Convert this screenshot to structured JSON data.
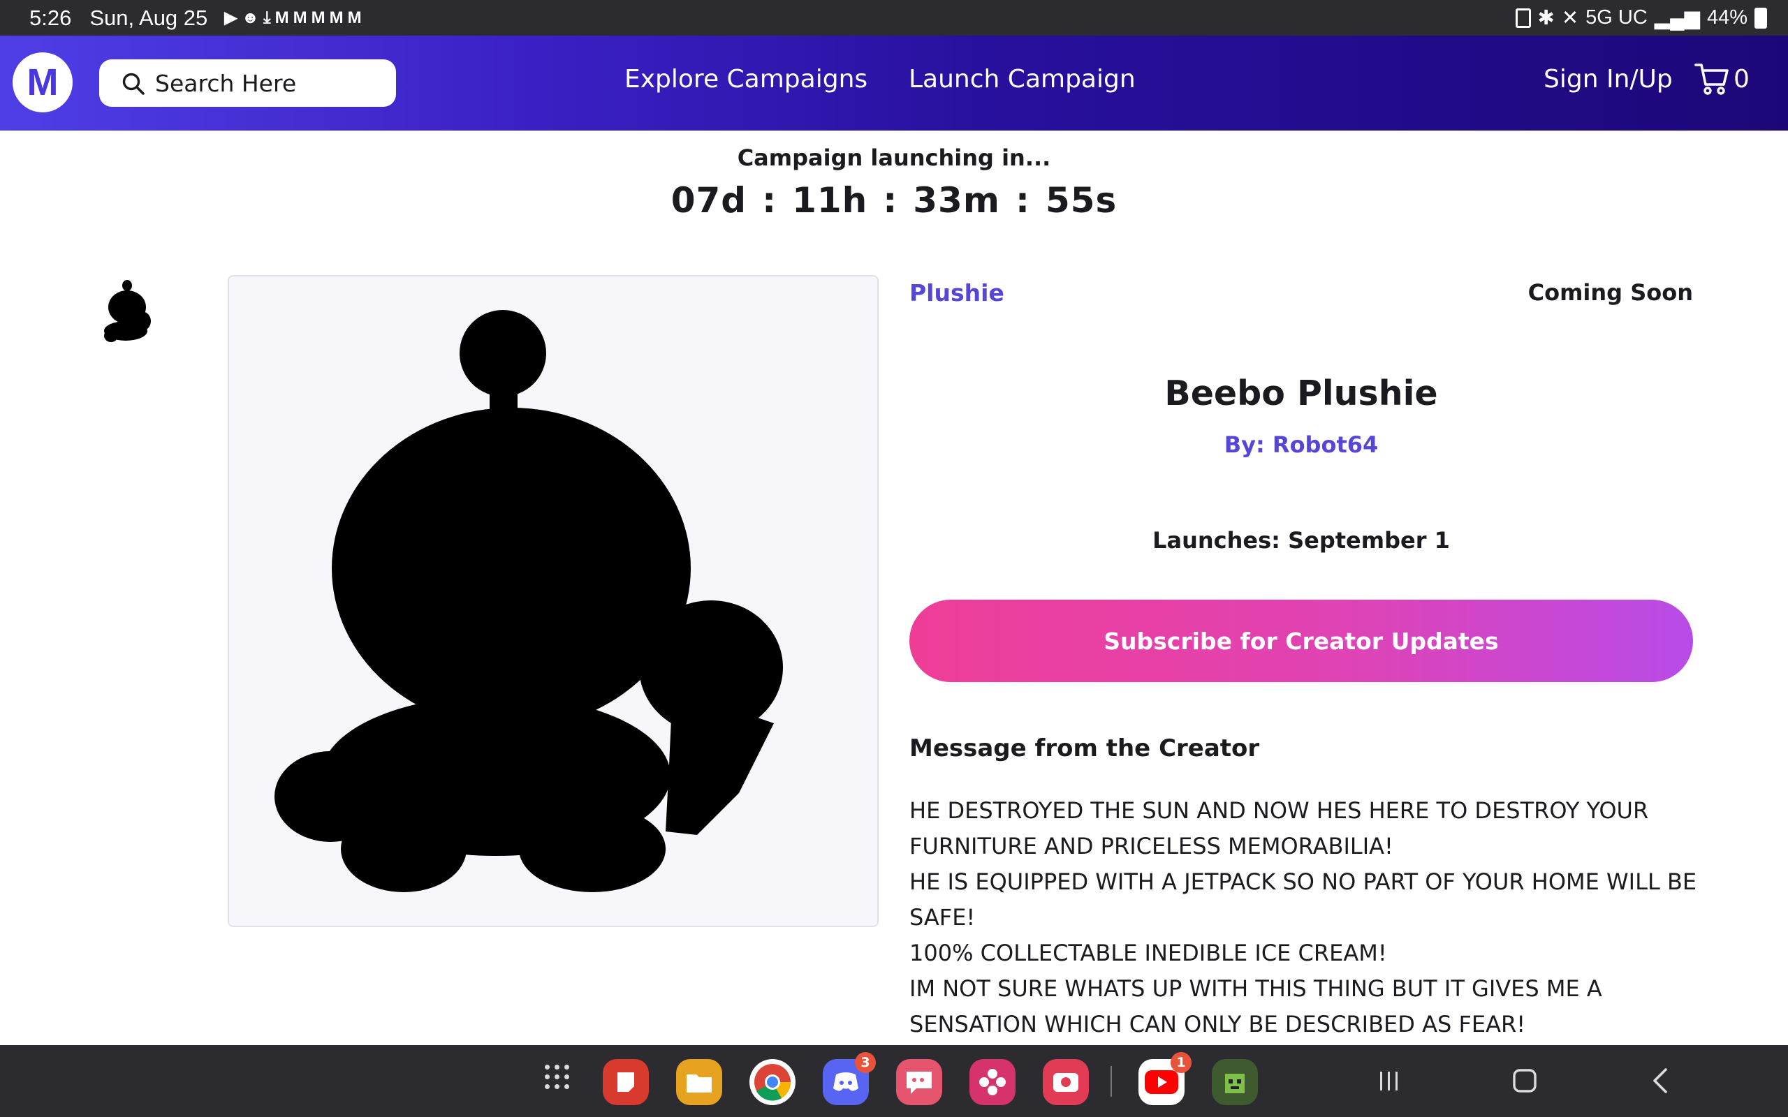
{
  "status_bar": {
    "time": "5:26",
    "date": "Sun, Aug 25",
    "notification_icons": [
      "youtube-icon",
      "discord-icon",
      "download-icon",
      "gmail-icon",
      "gmail-icon",
      "gmail-icon",
      "gmail-icon",
      "gmail-icon"
    ],
    "network": "5G UC",
    "battery": "44%"
  },
  "header": {
    "logo_letter": "M",
    "search_placeholder": "Search Here",
    "nav_explore": "Explore Campaigns",
    "nav_launch": "Launch Campaign",
    "sign_in": "Sign In/Up",
    "cart_count": "0"
  },
  "countdown": {
    "title": "Campaign launching in...",
    "days": "07d",
    "hours": "11h",
    "minutes": "33m",
    "seconds": "55s",
    "separator": ":"
  },
  "product": {
    "category": "Plushie",
    "status": "Coming Soon",
    "title": "Beebo Plushie",
    "author": "By: Robot64",
    "launches": "Launches: September 1",
    "subscribe_label": "Subscribe for Creator Updates",
    "message_title": "Message from the Creator",
    "message_lines": [
      "HE DESTROYED THE SUN AND NOW HES HERE TO DESTROY YOUR FURNITURE AND PRICELESS MEMORABILIA!",
      "HE IS EQUIPPED WITH A JETPACK SO NO PART OF YOUR HOME WILL BE SAFE!",
      "100% COLLECTABLE INEDIBLE ICE CREAM!",
      "IM NOT SURE WHATS UP WITH THIS THING BUT IT GIVES ME A SENSATION WHICH CAN ONLY BE DESCRIBED AS FEAR!"
    ]
  },
  "taskbar": {
    "apps": [
      {
        "name": "app-drawer-icon"
      },
      {
        "name": "notes-app-icon",
        "color": "#d83a2e"
      },
      {
        "name": "files-app-icon",
        "color": "#e7a21f"
      },
      {
        "name": "chrome-app-icon",
        "color": "#ffffff"
      },
      {
        "name": "discord-app-icon",
        "color": "#5865f2",
        "badge": "3"
      },
      {
        "name": "chat-app-icon",
        "color": "#e5556e"
      },
      {
        "name": "gallery-app-icon",
        "color": "#d6336c"
      },
      {
        "name": "screen-recorder-app-icon",
        "color": "#e23b56"
      },
      {
        "name": "youtube-app-icon",
        "color": "#ffffff",
        "badge": "1"
      },
      {
        "name": "game-app-icon",
        "color": "#3f5a2e"
      }
    ]
  },
  "colors": {
    "accent": "#5646d8",
    "header_start": "#4f3ee6",
    "header_end": "#1d0778",
    "button_start": "#ee3d96",
    "button_end": "#b84be8"
  }
}
